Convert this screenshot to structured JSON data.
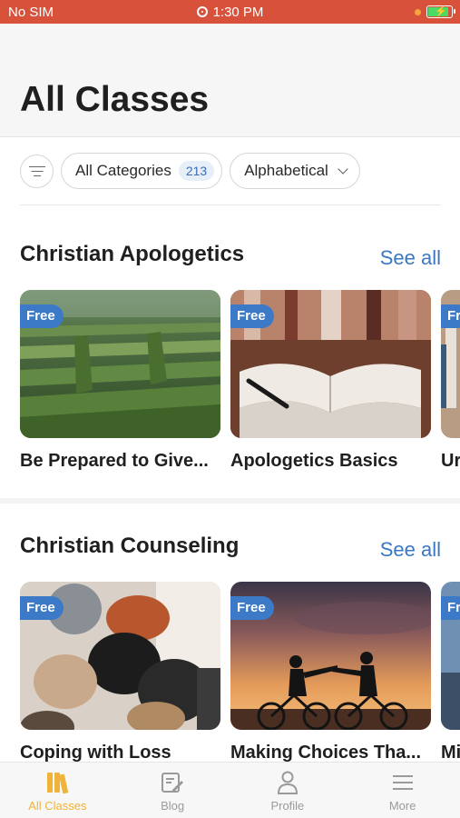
{
  "status_bar": {
    "carrier": "No SIM",
    "time": "1:30 PM"
  },
  "header": {
    "title": "All Classes"
  },
  "filters": {
    "category_label": "All Categories",
    "category_count": "213",
    "sort_label": "Alphabetical"
  },
  "sections": [
    {
      "title": "Christian Apologetics",
      "see_all": "See all",
      "cards": [
        {
          "badge": "Free",
          "title": "Be Prepared to Give..."
        },
        {
          "badge": "Free",
          "title": "Apologetics Basics"
        },
        {
          "badge": "Fr",
          "title": "Ur"
        }
      ]
    },
    {
      "title": "Christian Counseling",
      "see_all": "See all",
      "cards": [
        {
          "badge": "Free",
          "title": "Coping with Loss"
        },
        {
          "badge": "Free",
          "title": "Making Choices Tha..."
        },
        {
          "badge": "Fr",
          "title": "Mi"
        }
      ]
    }
  ],
  "tab_bar": {
    "items": [
      {
        "label": "All Classes",
        "icon": "books-icon",
        "active": true
      },
      {
        "label": "Blog",
        "icon": "blog-edit-icon",
        "active": false
      },
      {
        "label": "Profile",
        "icon": "person-icon",
        "active": false
      },
      {
        "label": "More",
        "icon": "menu-list-icon",
        "active": false
      }
    ]
  },
  "colors": {
    "status_bar": "#d8513b",
    "accent_blue": "#3a78c2",
    "badge_blue": "#3c79c6",
    "tab_active": "#f0b33a"
  }
}
